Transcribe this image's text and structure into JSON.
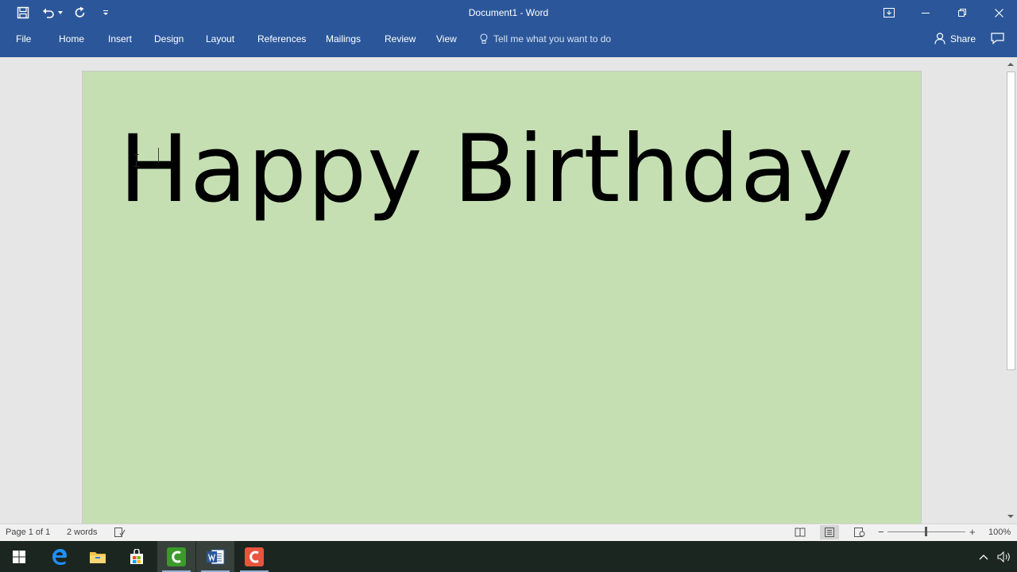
{
  "window": {
    "title": "Document1  -  Word"
  },
  "quick_access": {
    "icons": [
      "save-icon",
      "undo-icon",
      "undo-dropdown-icon",
      "redo-icon",
      "customize-icon"
    ]
  },
  "ribbon": {
    "tabs": [
      {
        "label": "File"
      },
      {
        "label": "Home"
      },
      {
        "label": "Insert"
      },
      {
        "label": "Design"
      },
      {
        "label": "Layout"
      },
      {
        "label": "References"
      },
      {
        "label": "Mailings"
      },
      {
        "label": "Review"
      },
      {
        "label": "View"
      }
    ],
    "tell_me": "Tell me what you want to do",
    "share_label": "Share"
  },
  "document": {
    "body_text": "Happy Birthday",
    "page_color": "#c5dfb3"
  },
  "status_bar": {
    "page": "Page 1 of 1",
    "words": "2 words",
    "zoom": "100%",
    "zoom_minus": "−",
    "zoom_plus": "+"
  },
  "colors": {
    "accent": "#2b579a"
  }
}
